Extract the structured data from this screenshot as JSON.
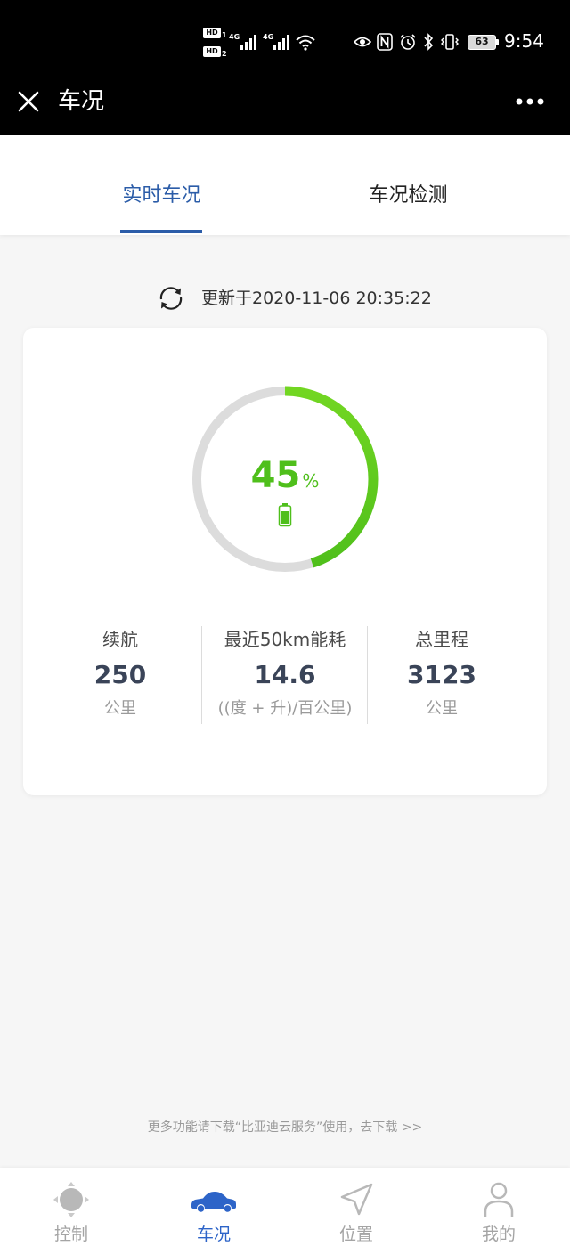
{
  "status_bar": {
    "sim1": {
      "badge": "HD",
      "index": "1",
      "network": "4G",
      "icon": "signal-icon"
    },
    "sim2": {
      "badge": "HD",
      "index": "2",
      "network": "4G",
      "icon": "signal-icon"
    },
    "indicators": [
      "wifi-icon",
      "eye-icon",
      "nfc-icon",
      "alarm-icon",
      "bluetooth-icon",
      "vibrate-icon"
    ],
    "battery": {
      "icon": "battery-icon",
      "level": "63"
    },
    "time": "9:54"
  },
  "title_bar": {
    "title": "车况",
    "close_icon": "close-icon",
    "more_icon": "more-icon"
  },
  "tabs": [
    {
      "label": "实时车况",
      "active": true
    },
    {
      "label": "车况检测",
      "active": false
    }
  ],
  "update_info": {
    "icon": "refresh-icon",
    "text": "更新于2020-11-06 20:35:22"
  },
  "battery_gauge": {
    "value": "45",
    "unit": "%",
    "fill_percent": 45,
    "icon": "battery-icon"
  },
  "stats": [
    {
      "label": "续航",
      "value": "250",
      "unit": "公里"
    },
    {
      "label": "最近50km能耗",
      "value": "14.6",
      "unit": "((度 + 升)/百公里)"
    },
    {
      "label": "总里程",
      "value": "3123",
      "unit": "公里"
    }
  ],
  "footer_note": "更多功能请下载“比亚迪云服务”使用，去下载 >>",
  "bottom_nav": [
    {
      "label": "控制",
      "icon": "control-icon",
      "active": false
    },
    {
      "label": "车况",
      "icon": "car-icon",
      "active": true
    },
    {
      "label": "位置",
      "icon": "location-arrow-icon",
      "active": false
    },
    {
      "label": "我的",
      "icon": "person-icon",
      "active": false
    }
  ],
  "colors": {
    "accent_blue": "#2b5ca8",
    "nav_active": "#2d64c8",
    "gauge_green": "#4fbf1b",
    "gauge_track": "#dcdcdc",
    "value_text": "#3a4458",
    "header_bg": "#000000",
    "page_bg": "#f6f6f6"
  }
}
